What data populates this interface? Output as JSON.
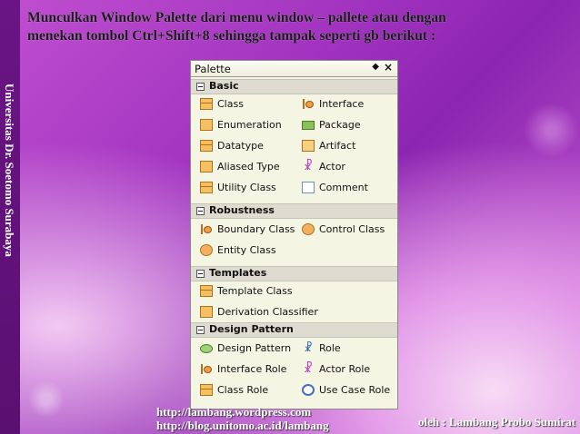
{
  "sidebar": {
    "text": "Universitas Dr. Soetomo Surabaya"
  },
  "heading": {
    "line1": "Munculkan Window Palette dari menu window – pallete atau dengan",
    "line2": "menekan tombol Ctrl+Shift+8 sehingga tampak seperti gb berikut :"
  },
  "palette": {
    "title": "Palette",
    "pin_glyph": "◆",
    "close_glyph": "×",
    "sections": {
      "basic": {
        "label": "Basic",
        "items": [
          "Class",
          "Interface",
          "Enumeration",
          "Package",
          "Datatype",
          "Artifact",
          "Aliased Type",
          "Actor",
          "Utility Class",
          "Comment"
        ]
      },
      "robustness": {
        "label": "Robustness",
        "items": [
          "Boundary Class",
          "Control Class",
          "Entity Class"
        ]
      },
      "templates": {
        "label": "Templates",
        "items": [
          "Template Class",
          "Derivation Classifier"
        ]
      },
      "design": {
        "label": "Design Pattern",
        "items": [
          "Design Pattern",
          "Role",
          "Interface Role",
          "Actor Role",
          "Class Role",
          "Use Case Role"
        ]
      }
    }
  },
  "footer": {
    "url1": "http://lambang.wordpress.com",
    "url2": "http://blog.unitomo.ac.id/lambang",
    "author": "oleh : Lambang Probo Sumirat"
  }
}
